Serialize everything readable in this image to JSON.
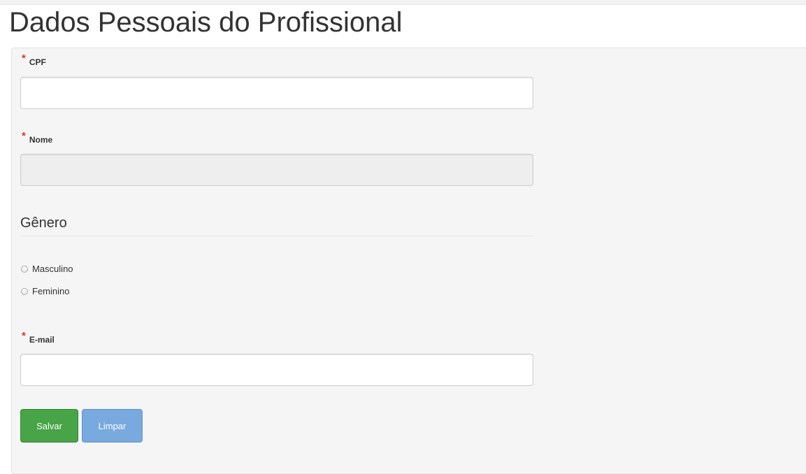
{
  "page": {
    "title": "Dados Pessoais do Profissional"
  },
  "form": {
    "required_mark": "*",
    "cpf": {
      "label": "CPF",
      "value": ""
    },
    "nome": {
      "label": "Nome",
      "value": "",
      "disabled": true
    },
    "genero": {
      "legend": "Gênero",
      "options": [
        "Masculino",
        "Feminino"
      ],
      "selected": null
    },
    "email": {
      "label": "E-mail",
      "value": ""
    }
  },
  "buttons": {
    "save_label": "Salvar",
    "clear_label": "Limpar"
  },
  "colors": {
    "required": "#d9342b",
    "save_button": "#47a447",
    "clear_button": "#78a9df",
    "panel_background": "#f5f5f5"
  }
}
